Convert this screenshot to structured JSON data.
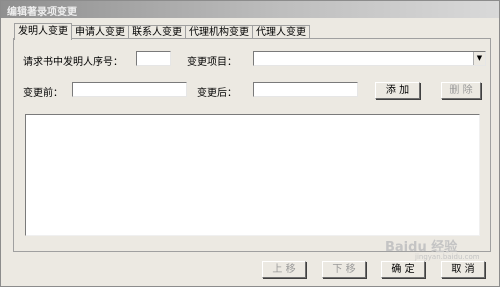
{
  "window": {
    "title": "编辑著录项变更"
  },
  "tabs": [
    {
      "label": "发明人变更"
    },
    {
      "label": "申请人变更"
    },
    {
      "label": "联系人变更"
    },
    {
      "label": "代理机构变更"
    },
    {
      "label": "代理人变更"
    }
  ],
  "form": {
    "seq_label": "请求书中发明人序号：",
    "seq_value": "",
    "item_label": "变更项目：",
    "item_value": "",
    "before_label": "变更前：",
    "before_value": "",
    "after_label": "变更后：",
    "after_value": ""
  },
  "buttons": {
    "add": "添 加",
    "delete": "删 除",
    "up": "上 移",
    "down": "下 移",
    "ok": "确 定",
    "cancel": "取 消"
  },
  "watermark": {
    "text": "Baidu 经验",
    "sub": "jingyan.baidu.com"
  }
}
